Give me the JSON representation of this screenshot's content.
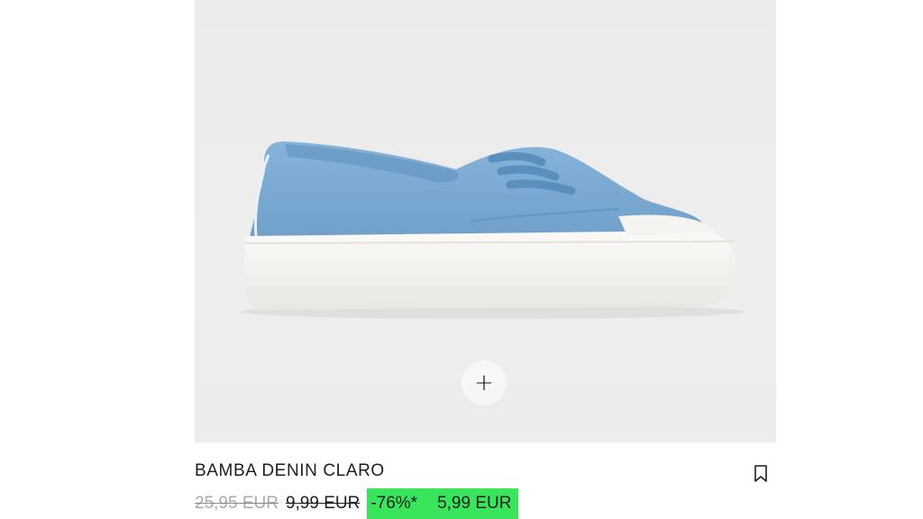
{
  "product": {
    "title": "BAMBA DENIN CLARO",
    "image_alt": "Light denim platform sneaker",
    "add_label": "+",
    "prices": {
      "original": "25,95 EUR",
      "previous": "9,99 EUR",
      "discount": "-76%*",
      "current": "5,99 EUR"
    },
    "colors": {
      "discount_badge": "#39e55a",
      "denim": "#7aa9d1",
      "sole": "#f7f6f2"
    }
  }
}
